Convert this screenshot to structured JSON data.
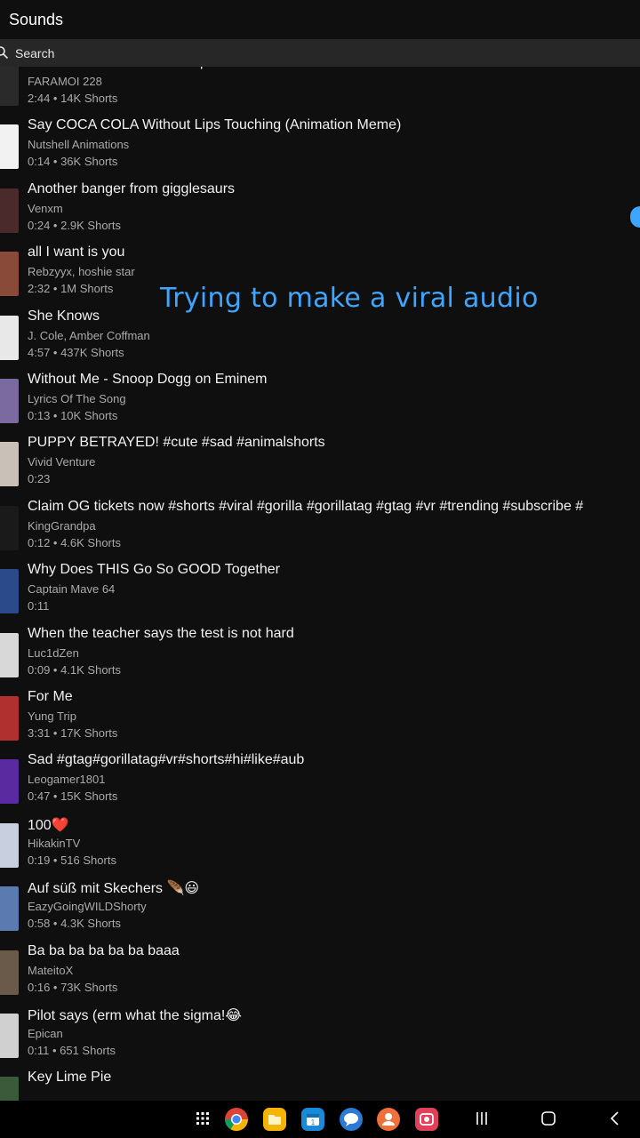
{
  "header": {
    "title": "Sounds"
  },
  "search": {
    "placeholder": "Search"
  },
  "overlay": {
    "caption": "Trying to make a viral audio"
  },
  "colors": {
    "background": "#0f0f0f",
    "search_bar": "#272727",
    "accent": "#3ea6ff",
    "secondary_text": "#aaaaaa"
  },
  "sounds": [
    {
      "title": "Blod Besvimelse - Misantrop",
      "artist": "FARAMOI 228",
      "meta": "2:44 • 14K Shorts",
      "thumb": "#2a2a2a"
    },
    {
      "title": "Say COCA COLA Without Lips Touching (Animation Meme)",
      "artist": "Nutshell Animations",
      "meta": "0:14 • 36K Shorts",
      "thumb": "#f2f2f2"
    },
    {
      "title": "Another banger from gigglesaurs",
      "artist": "Venxm",
      "meta": "0:24 • 2.9K Shorts",
      "thumb": "#4a2a2a"
    },
    {
      "title": "all I want is you",
      "artist": "Rebzyyx, hoshie star",
      "meta": "2:32 • 1M Shorts",
      "thumb": "#8a4a3a"
    },
    {
      "title": "She Knows",
      "artist": "J. Cole, Amber Coffman",
      "meta": "4:57 • 437K Shorts",
      "thumb": "#e8e8e8"
    },
    {
      "title": "Without Me - Snoop Dogg on Eminem",
      "artist": "Lyrics Of The Song",
      "meta": "0:13 • 10K Shorts",
      "thumb": "#7a6aa0"
    },
    {
      "title": "PUPPY BETRAYED! #cute #sad #animalshorts",
      "artist": "Vivid Venture",
      "meta": "0:23",
      "thumb": "#c9c0b8"
    },
    {
      "title": "Claim OG tickets now #shorts #viral #gorilla #gorillatag #gtag #vr #trending #subscribe #",
      "artist": "KingGrandpa",
      "meta": "0:12 • 4.6K Shorts",
      "thumb": "#1a1a1a"
    },
    {
      "title": "Why Does THIS Go So GOOD Together",
      "artist": "Captain Mave 64",
      "meta": "0:11",
      "thumb": "#2a4a8a"
    },
    {
      "title": "When the teacher says the test is not hard",
      "artist": "Luc1dZen",
      "meta": "0:09 • 4.1K Shorts",
      "thumb": "#d8d8d8"
    },
    {
      "title": "For Me",
      "artist": "Yung Trip",
      "meta": "3:31 • 17K Shorts",
      "thumb": "#b03030"
    },
    {
      "title": "Sad #gtag#gorillatag#vr#shorts#hi#like#aub",
      "artist": "Leogamer1801",
      "meta": "0:47 • 15K Shorts",
      "thumb": "#5a2aa0"
    },
    {
      "title": "100❤️",
      "artist": "HikakinTV",
      "meta": "0:19 • 516 Shorts",
      "thumb": "#c8d0e0"
    },
    {
      "title": "Auf süß mit Skechers 🪶😃",
      "artist": "EazyGoingWILDShorty",
      "meta": "0:58 • 4.3K Shorts",
      "thumb": "#5a7ab0"
    },
    {
      "title": "Ba ba ba ba ba ba baaa",
      "artist": "MateitoX",
      "meta": "0:16 • 73K Shorts",
      "thumb": "#6a5a4a"
    },
    {
      "title": "Pilot says (erm what the sigma!😂",
      "artist": "Epican",
      "meta": "0:11 • 651 Shorts",
      "thumb": "#d0d0d0"
    },
    {
      "title": "Key Lime Pie",
      "artist": "",
      "meta": "",
      "thumb": "#3a5a3a"
    }
  ],
  "taskbar": {
    "apps": [
      {
        "name": "app-drawer-icon",
        "color": "#000000"
      },
      {
        "name": "chrome-icon",
        "color": "#ffffff"
      },
      {
        "name": "my-files-icon",
        "color": "#f5b400"
      },
      {
        "name": "calendar-icon",
        "color": "#1a8ad6"
      },
      {
        "name": "messages-icon",
        "color": "#2a7ad6"
      },
      {
        "name": "contacts-icon",
        "color": "#f0703a"
      },
      {
        "name": "screen-recorder-icon",
        "color": "#e0405a"
      }
    ]
  }
}
